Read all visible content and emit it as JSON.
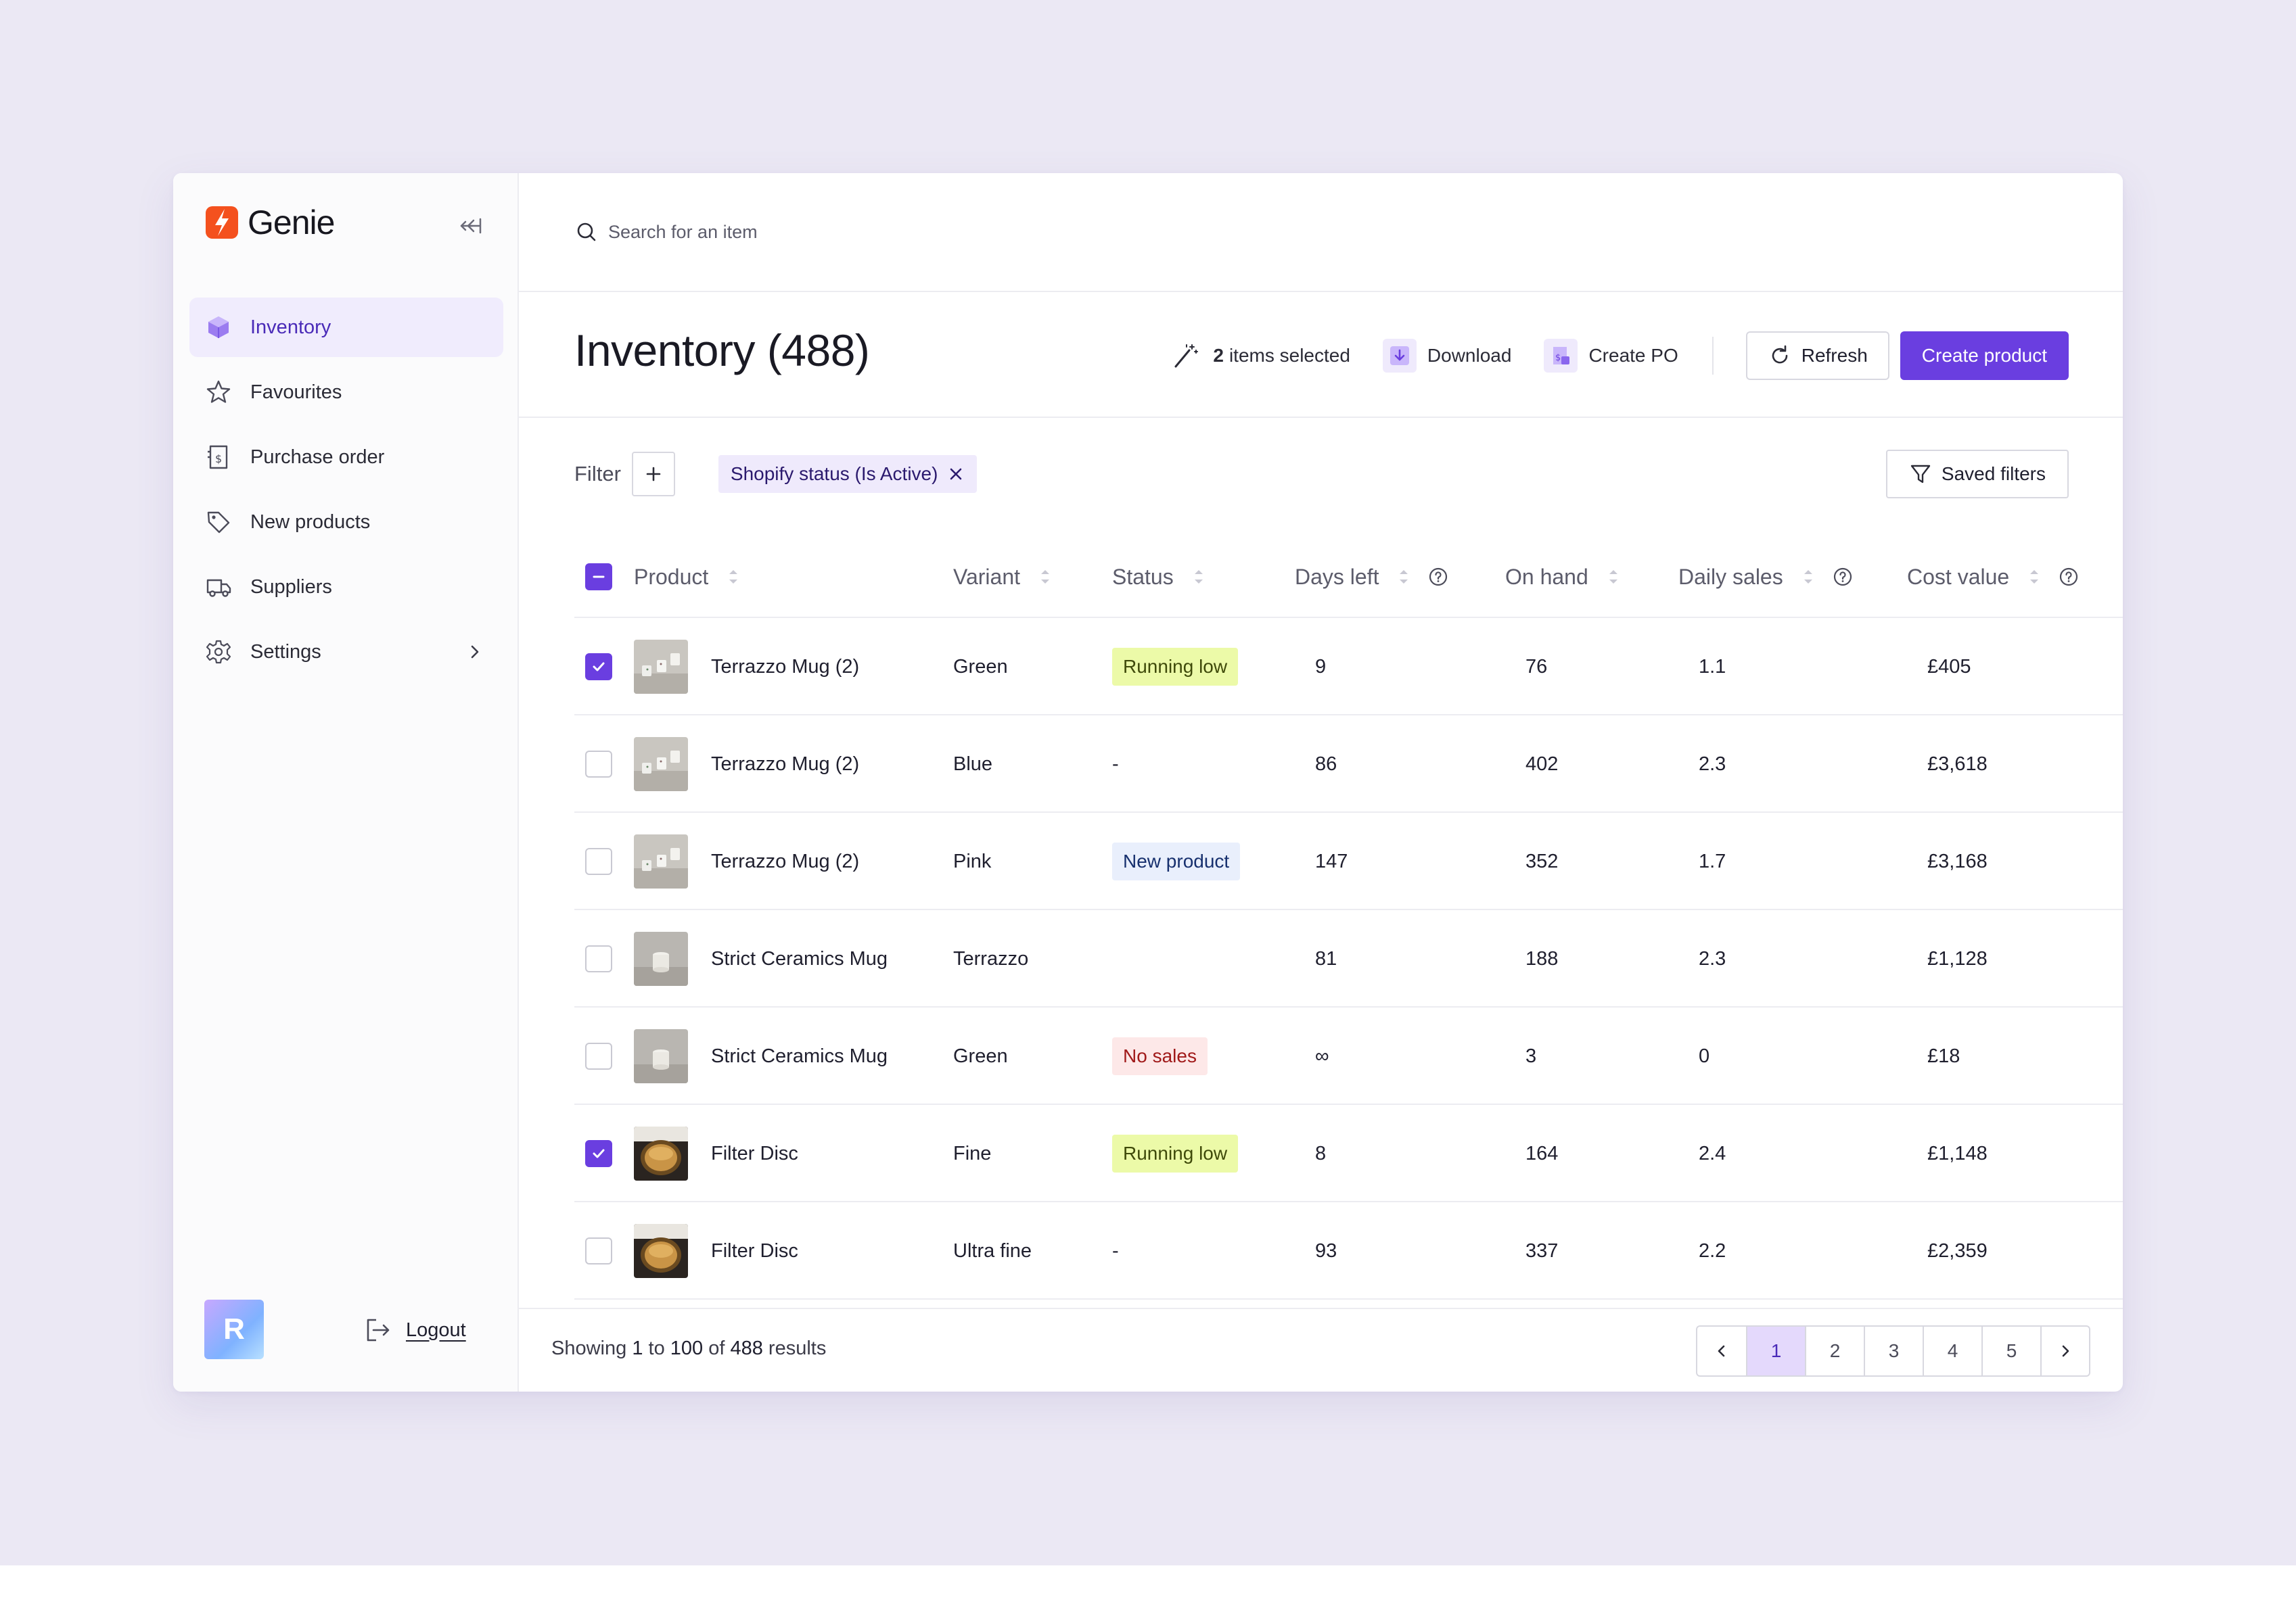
{
  "app": {
    "name": "Genie",
    "accent": "#6a3ee0",
    "logo_color": "#f4511e"
  },
  "sidebar": {
    "collapse_icon": "collapse-left-icon",
    "items": [
      {
        "label": "Inventory",
        "icon": "box-icon",
        "active": true
      },
      {
        "label": "Favourites",
        "icon": "star-icon"
      },
      {
        "label": "Purchase order",
        "icon": "receipt-icon"
      },
      {
        "label": "New products",
        "icon": "tag-icon"
      },
      {
        "label": "Suppliers",
        "icon": "truck-icon"
      },
      {
        "label": "Settings",
        "icon": "gear-icon",
        "has_submenu": true
      }
    ],
    "user_initial": "R",
    "logout_label": "Logout"
  },
  "search": {
    "placeholder": "Search for an item"
  },
  "header": {
    "title": "Inventory (488)",
    "selected_count": "2",
    "selected_label": "items selected",
    "download_label": "Download",
    "create_po_label": "Create PO",
    "refresh_label": "Refresh",
    "create_product_label": "Create product"
  },
  "filters": {
    "label": "Filter",
    "active_chip": "Shopify status (Is Active)",
    "saved_label": "Saved filters"
  },
  "table": {
    "columns": {
      "product": "Product",
      "variant": "Variant",
      "status": "Status",
      "days_left": "Days left",
      "on_hand": "On hand",
      "daily_sales": "Daily sales",
      "cost_value": "Cost value"
    },
    "rows": [
      {
        "checked": true,
        "product": "Terrazzo Mug (2)",
        "thumb": "mug-image",
        "variant": "Green",
        "status": "Running low",
        "status_kind": "low",
        "days_left": "9",
        "on_hand": "76",
        "daily_sales": "1.1",
        "cost_value": "£405"
      },
      {
        "checked": false,
        "product": "Terrazzo Mug (2)",
        "thumb": "mug-image",
        "variant": "Blue",
        "status": "-",
        "status_kind": "text",
        "days_left": "86",
        "on_hand": "402",
        "daily_sales": "2.3",
        "cost_value": "£3,618"
      },
      {
        "checked": false,
        "product": "Terrazzo Mug (2)",
        "thumb": "mug-image",
        "variant": "Pink",
        "status": "New product",
        "status_kind": "new",
        "days_left": "147",
        "on_hand": "352",
        "daily_sales": "1.7",
        "cost_value": "£3,168"
      },
      {
        "checked": false,
        "product": "Strict Ceramics Mug",
        "thumb": "cup-image",
        "variant": "Terrazzo",
        "status": "",
        "status_kind": "text",
        "days_left": "81",
        "on_hand": "188",
        "daily_sales": "2.3",
        "cost_value": "£1,128"
      },
      {
        "checked": false,
        "product": "Strict Ceramics Mug",
        "thumb": "cup-image",
        "variant": "Green",
        "status": "No sales",
        "status_kind": "none",
        "days_left": "∞",
        "on_hand": "3",
        "daily_sales": "0",
        "cost_value": "£18"
      },
      {
        "checked": true,
        "product": "Filter Disc",
        "thumb": "disc-image",
        "variant": "Fine",
        "status": "Running low",
        "status_kind": "low",
        "days_left": "8",
        "on_hand": "164",
        "daily_sales": "2.4",
        "cost_value": "£1,148"
      },
      {
        "checked": false,
        "product": "Filter Disc",
        "thumb": "disc-image",
        "variant": "Ultra fine",
        "status": "-",
        "status_kind": "text",
        "days_left": "93",
        "on_hand": "337",
        "daily_sales": "2.2",
        "cost_value": "£2,359"
      }
    ]
  },
  "footer": {
    "showing_prefix": "Showing",
    "from": "1",
    "to_word": "to",
    "to": "100",
    "of_word": "of",
    "total": "488",
    "suffix": "results",
    "pages": [
      "1",
      "2",
      "3",
      "4",
      "5"
    ],
    "current_page": "1"
  }
}
